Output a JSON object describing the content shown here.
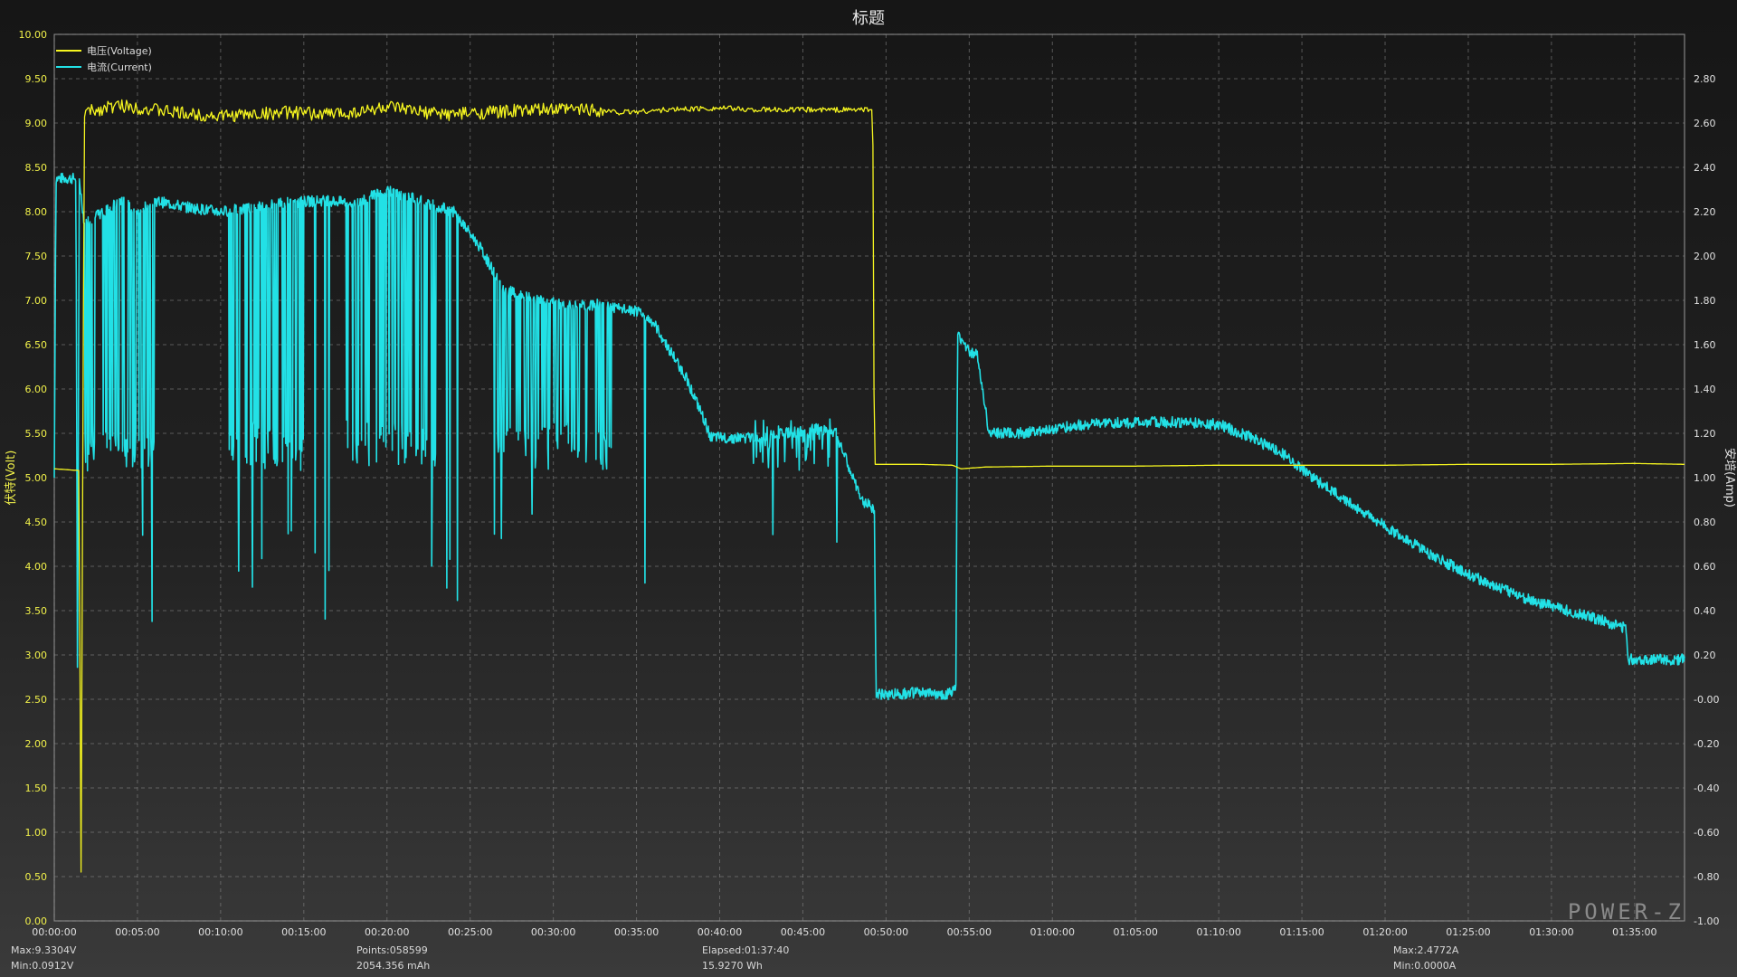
{
  "chart_data": {
    "type": "line",
    "title": "标题",
    "x_label": "",
    "x_ticks": [
      "00:00:00",
      "00:05:00",
      "00:10:00",
      "00:15:00",
      "00:20:00",
      "00:25:00",
      "00:30:00",
      "00:35:00",
      "00:40:00",
      "00:45:00",
      "00:50:00",
      "00:55:00",
      "01:00:00",
      "01:05:00",
      "01:10:00",
      "01:15:00",
      "01:20:00",
      "01:25:00",
      "01:30:00",
      "01:35:00"
    ],
    "x_range_min": [
      0,
      98
    ],
    "y_left": {
      "label": "伏特(Volt)",
      "range": [
        0,
        10
      ],
      "ticks": [
        "10.00",
        "9.50",
        "9.00",
        "8.50",
        "8.00",
        "7.50",
        "7.00",
        "6.50",
        "6.00",
        "5.50",
        "5.00",
        "4.50",
        "4.00",
        "3.50",
        "3.00",
        "2.50",
        "2.00",
        "1.50",
        "1.00",
        "0.50",
        "0.00"
      ]
    },
    "y_right": {
      "label": "安培(Amp)",
      "range": [
        -1.0,
        3.0
      ],
      "ticks": [
        "2.80",
        "2.60",
        "2.40",
        "2.20",
        "2.00",
        "1.80",
        "1.60",
        "1.40",
        "1.20",
        "1.00",
        "0.80",
        "0.60",
        "0.40",
        "0.20",
        "-0.00",
        "-0.20",
        "-0.40",
        "-0.60",
        "-0.80",
        "-1.00"
      ]
    },
    "legend_position": "top-left",
    "grid": true,
    "series": [
      {
        "name": "电压(Voltage)",
        "axis": "left",
        "color": "#f5f51f",
        "points_min_v": [
          [
            0,
            5.1
          ],
          [
            1.5,
            5.08
          ],
          [
            1.6,
            0.1
          ],
          [
            1.8,
            9.12
          ],
          [
            4,
            9.2
          ],
          [
            6,
            9.15
          ],
          [
            8,
            9.1
          ],
          [
            10,
            9.08
          ],
          [
            12,
            9.1
          ],
          [
            14,
            9.12
          ],
          [
            16,
            9.1
          ],
          [
            18,
            9.12
          ],
          [
            20,
            9.18
          ],
          [
            22,
            9.12
          ],
          [
            24,
            9.1
          ],
          [
            26,
            9.12
          ],
          [
            28,
            9.14
          ],
          [
            30,
            9.15
          ],
          [
            32,
            9.16
          ],
          [
            34,
            9.12
          ],
          [
            36,
            9.14
          ],
          [
            38,
            9.16
          ],
          [
            40,
            9.17
          ],
          [
            42,
            9.15
          ],
          [
            44,
            9.15
          ],
          [
            46,
            9.15
          ],
          [
            48,
            9.15
          ],
          [
            49.2,
            9.15
          ],
          [
            49.3,
            5.15
          ],
          [
            52,
            5.15
          ],
          [
            54,
            5.14
          ],
          [
            54.5,
            5.1
          ],
          [
            56,
            5.12
          ],
          [
            60,
            5.13
          ],
          [
            65,
            5.13
          ],
          [
            70,
            5.14
          ],
          [
            75,
            5.14
          ],
          [
            80,
            5.14
          ],
          [
            85,
            5.15
          ],
          [
            90,
            5.15
          ],
          [
            95,
            5.16
          ],
          [
            98,
            5.15
          ]
        ]
      },
      {
        "name": "电流(Current)",
        "axis": "right",
        "color": "#22e1e6",
        "points_min_a": [
          [
            0,
            1.0
          ],
          [
            0.1,
            2.35
          ],
          [
            1.3,
            2.35
          ],
          [
            1.4,
            0.0
          ],
          [
            1.5,
            2.35
          ],
          [
            1.8,
            2.15
          ],
          [
            3,
            2.2
          ],
          [
            4,
            2.25
          ],
          [
            5,
            2.2
          ],
          [
            6,
            2.25
          ],
          [
            8,
            2.22
          ],
          [
            10,
            2.2
          ],
          [
            12,
            2.22
          ],
          [
            14,
            2.24
          ],
          [
            16,
            2.25
          ],
          [
            18,
            2.24
          ],
          [
            20,
            2.3
          ],
          [
            22,
            2.25
          ],
          [
            24,
            2.2
          ],
          [
            25.5,
            2.05
          ],
          [
            27,
            1.85
          ],
          [
            29,
            1.8
          ],
          [
            31,
            1.78
          ],
          [
            33,
            1.78
          ],
          [
            34,
            1.76
          ],
          [
            35,
            1.75
          ],
          [
            36,
            1.7
          ],
          [
            38,
            1.45
          ],
          [
            39.5,
            1.18
          ],
          [
            42,
            1.18
          ],
          [
            44,
            1.2
          ],
          [
            46,
            1.22
          ],
          [
            47,
            1.2
          ],
          [
            48.5,
            0.9
          ],
          [
            49.3,
            0.86
          ],
          [
            49.4,
            0.02
          ],
          [
            52,
            0.03
          ],
          [
            53.5,
            0.02
          ],
          [
            54.2,
            0.04
          ],
          [
            54.3,
            1.65
          ],
          [
            55,
            1.57
          ],
          [
            55.5,
            1.55
          ],
          [
            56.2,
            1.2
          ],
          [
            58,
            1.2
          ],
          [
            60,
            1.22
          ],
          [
            62,
            1.24
          ],
          [
            65,
            1.25
          ],
          [
            68,
            1.25
          ],
          [
            70,
            1.24
          ],
          [
            72,
            1.18
          ],
          [
            74,
            1.1
          ],
          [
            76,
            0.98
          ],
          [
            78,
            0.88
          ],
          [
            80,
            0.78
          ],
          [
            83,
            0.64
          ],
          [
            86,
            0.53
          ],
          [
            89,
            0.44
          ],
          [
            92,
            0.38
          ],
          [
            94.5,
            0.32
          ],
          [
            94.6,
            0.18
          ],
          [
            98,
            0.18
          ]
        ],
        "bursts_min": [
          [
            1.8,
            6
          ],
          [
            10.5,
            15
          ],
          [
            17.5,
            23
          ],
          [
            26.5,
            33.5
          ],
          [
            42,
            47
          ]
        ]
      }
    ],
    "stats": {
      "max_v": "Max:9.3304V",
      "min_v": "Min:0.0912V",
      "points": "Points:058599",
      "capacity": "2054.356 mAh",
      "elapsed": "Elapsed:01:37:40",
      "energy": "15.9270 Wh",
      "max_a": "Max:2.4772A",
      "min_a": "Min:0.0000A"
    },
    "brand": "POWER-Z"
  }
}
